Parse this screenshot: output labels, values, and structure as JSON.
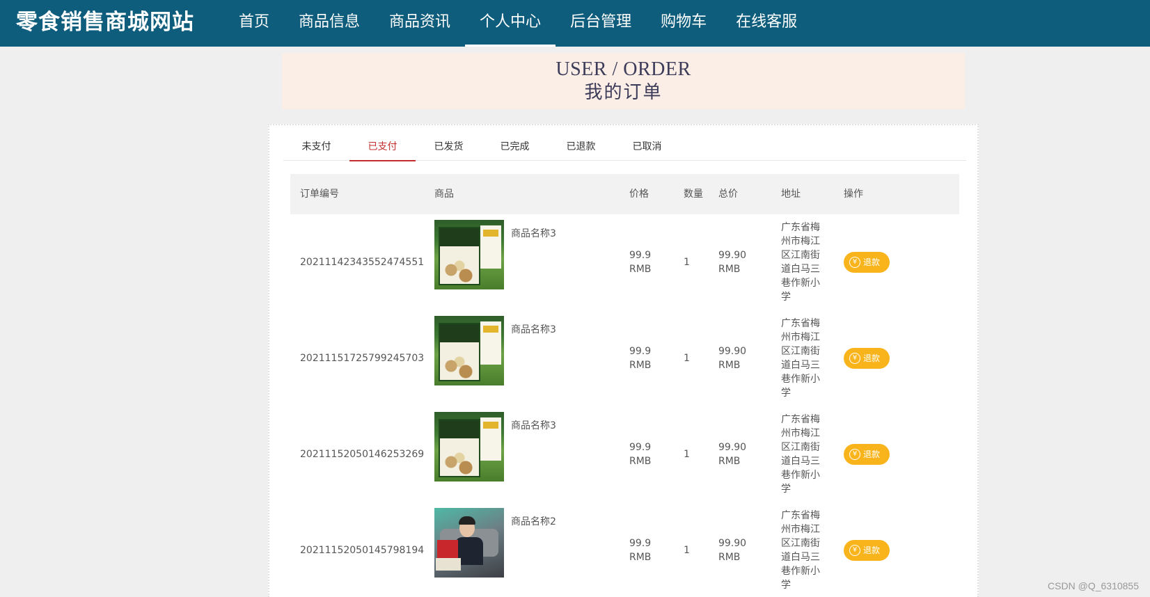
{
  "header": {
    "brand": "零食销售商城网站",
    "nav": [
      {
        "label": "首页"
      },
      {
        "label": "商品信息"
      },
      {
        "label": "商品资讯"
      },
      {
        "label": "个人中心",
        "active": true
      },
      {
        "label": "后台管理"
      },
      {
        "label": "购物车"
      },
      {
        "label": "在线客服"
      }
    ]
  },
  "banner": {
    "title_en": "USER / ORDER",
    "title_cn": "我的订单"
  },
  "tabs": [
    {
      "label": "未支付"
    },
    {
      "label": "已支付",
      "active": true
    },
    {
      "label": "已发货"
    },
    {
      "label": "已完成"
    },
    {
      "label": "已退款"
    },
    {
      "label": "已取消"
    }
  ],
  "table": {
    "headers": {
      "order_no": "订单编号",
      "product": "商品",
      "price": "价格",
      "qty": "数量",
      "total": "总价",
      "address": "地址",
      "action": "操作"
    },
    "rows": [
      {
        "order_no": "20211142343552474551",
        "thumb_icon": "nut-box-image",
        "product_name": "商品名称3",
        "price": "99.9 RMB",
        "qty": "1",
        "total": "99.90 RMB",
        "address": "广东省梅州市梅江区江南街道白马三巷作新小学",
        "action": "退款"
      },
      {
        "order_no": "20211151725799245703",
        "thumb_icon": "nut-box-image",
        "product_name": "商品名称3",
        "price": "99.9 RMB",
        "qty": "1",
        "total": "99.90 RMB",
        "address": "广东省梅州市梅江区江南街道白马三巷作新小学",
        "action": "退款"
      },
      {
        "order_no": "20211152050146253269",
        "thumb_icon": "nut-box-image",
        "product_name": "商品名称3",
        "price": "99.9 RMB",
        "qty": "1",
        "total": "99.90 RMB",
        "address": "广东省梅州市梅江区江南街道白马三巷作新小学",
        "action": "退款"
      },
      {
        "order_no": "20211152050145798194",
        "thumb_icon": "person-snack-image",
        "product_name": "商品名称2",
        "price": "99.9 RMB",
        "qty": "1",
        "total": "99.90 RMB",
        "address": "广东省梅州市梅江区江南街道白马三巷作新小学",
        "action": "退款"
      }
    ]
  },
  "watermark": "CSDN @Q_6310855",
  "colors": {
    "header_bg": "#0f5d7c",
    "active_tab": "#c42d2d",
    "refund_button": "#f9b41b",
    "banner_bg": "#fbeee6"
  }
}
